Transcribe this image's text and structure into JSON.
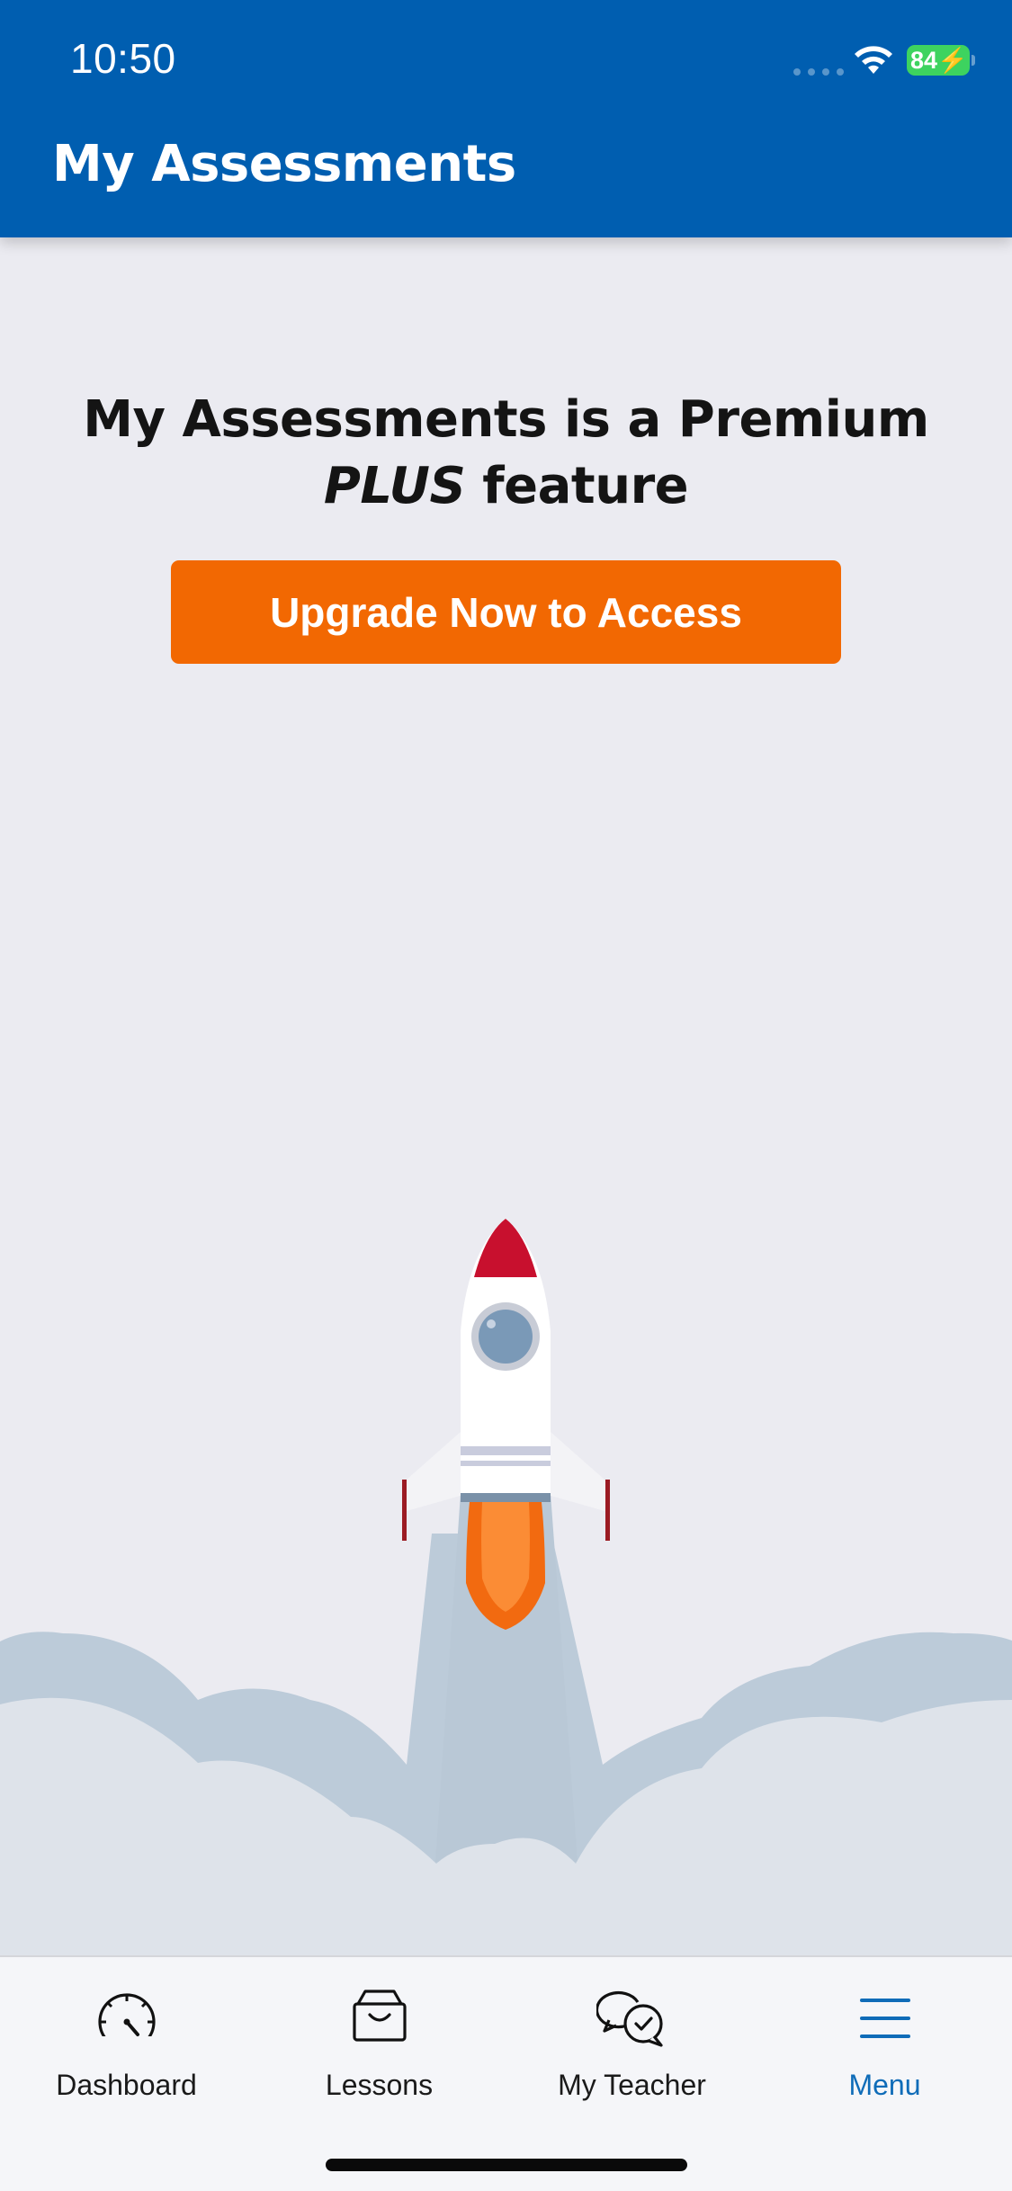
{
  "status_bar": {
    "time": "10:50",
    "battery": "84"
  },
  "header": {
    "title": "My Assessments"
  },
  "main": {
    "heading_line1": "My Assessments is a Premium",
    "heading_plus": "PLUS",
    "heading_feature": " feature",
    "upgrade_button": "Upgrade Now to Access"
  },
  "tabs": [
    {
      "label": "Dashboard",
      "icon": "speedometer-icon",
      "active": false
    },
    {
      "label": "Lessons",
      "icon": "inbox-tray-icon",
      "active": false
    },
    {
      "label": "My Teacher",
      "icon": "chat-bubbles-icon",
      "active": false
    },
    {
      "label": "Menu",
      "icon": "hamburger-menu-icon",
      "active": true
    }
  ],
  "colors": {
    "header_bg": "#005eb0",
    "page_bg": "#ebebf1",
    "cta_orange": "#f26802",
    "active_tab": "#0f6cb8",
    "battery_green": "#3dd35f",
    "rocket_nose": "#c8102e",
    "flame": "#f47216"
  }
}
